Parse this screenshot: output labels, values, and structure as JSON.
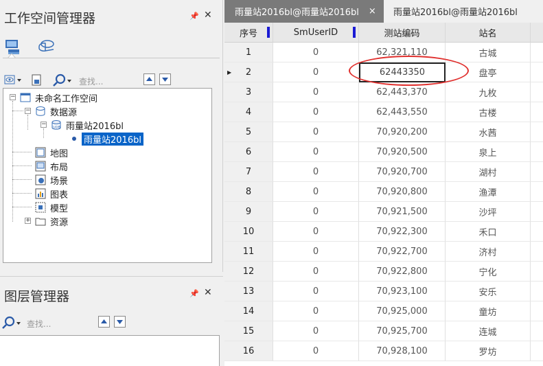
{
  "workspace_panel": {
    "title": "工作空间管理器",
    "search_placeholder": "查找...",
    "tree": [
      {
        "label": "未命名工作空间",
        "icon": "workspace-icon"
      },
      {
        "label": "数据源",
        "icon": "datasource-icon"
      },
      {
        "label": "雨量站2016bl",
        "icon": "udb-icon"
      },
      {
        "label": "雨量站2016bl",
        "icon": "point-dataset-icon",
        "selected": true
      },
      {
        "label": "地图",
        "icon": "map-icon"
      },
      {
        "label": "布局",
        "icon": "layout-icon"
      },
      {
        "label": "场景",
        "icon": "scene-icon"
      },
      {
        "label": "图表",
        "icon": "chart-icon"
      },
      {
        "label": "模型",
        "icon": "model-icon"
      },
      {
        "label": "资源",
        "icon": "folder-icon"
      }
    ]
  },
  "layer_panel": {
    "title": "图层管理器",
    "search_placeholder": "查找..."
  },
  "tabs": [
    {
      "label": "雨量站2016bl@雨量站2016bl",
      "active": true,
      "close": "×"
    },
    {
      "label": "雨量站2016bl@雨量站2016bl",
      "active": false
    }
  ],
  "table": {
    "columns": [
      "序号",
      "SmUserID",
      "测站编码",
      "站名"
    ],
    "rows": [
      [
        "1",
        "0",
        "62,321,110",
        "古城"
      ],
      [
        "2",
        "0",
        "62443350",
        "盘亭"
      ],
      [
        "3",
        "0",
        "62,443,370",
        "九枚"
      ],
      [
        "4",
        "0",
        "62,443,550",
        "古楼"
      ],
      [
        "5",
        "0",
        "70,920,200",
        "水茜"
      ],
      [
        "6",
        "0",
        "70,920,500",
        "泉上"
      ],
      [
        "7",
        "0",
        "70,920,700",
        "湖村"
      ],
      [
        "8",
        "0",
        "70,920,800",
        "渔潭"
      ],
      [
        "9",
        "0",
        "70,921,500",
        "沙坪"
      ],
      [
        "10",
        "0",
        "70,922,300",
        "禾口"
      ],
      [
        "11",
        "0",
        "70,922,700",
        "济村"
      ],
      [
        "12",
        "0",
        "70,922,800",
        "宁化"
      ],
      [
        "13",
        "0",
        "70,923,100",
        "安乐"
      ],
      [
        "14",
        "0",
        "70,925,000",
        "童坊"
      ],
      [
        "15",
        "0",
        "70,925,700",
        "连城"
      ],
      [
        "16",
        "0",
        "70,928,100",
        "罗坊"
      ]
    ],
    "editing_row": 1
  },
  "colors": {
    "accent": "#0a64c8",
    "highlight": "#e0302e",
    "active_tab": "#7a7a7a"
  }
}
